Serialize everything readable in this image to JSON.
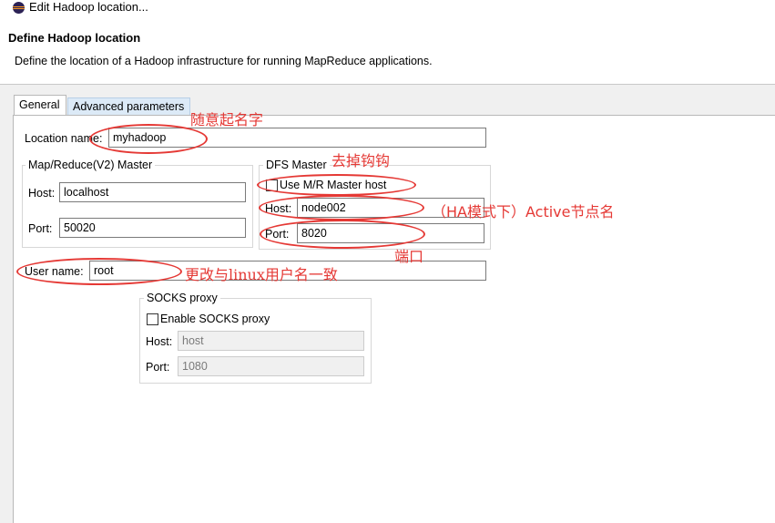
{
  "window": {
    "title": "Edit Hadoop location..."
  },
  "header": {
    "title": "Define Hadoop location",
    "description": "Define the location of a Hadoop infrastructure for running MapReduce applications."
  },
  "tabs": [
    {
      "label": "General",
      "selected": true
    },
    {
      "label": "Advanced parameters",
      "selected": false
    }
  ],
  "form": {
    "location_name": {
      "label": "Location name:",
      "value": "myhadoop"
    },
    "mapreduce_master": {
      "title": "Map/Reduce(V2) Master",
      "host": {
        "label": "Host:",
        "value": "localhost"
      },
      "port": {
        "label": "Port:",
        "value": "50020"
      }
    },
    "dfs_master": {
      "title": "DFS Master",
      "use_mr_host": {
        "label": "Use M/R Master host",
        "checked": false
      },
      "host": {
        "label": "Host:",
        "value": "node002"
      },
      "port": {
        "label": "Port:",
        "value": "8020"
      }
    },
    "user_name": {
      "label": "User name:",
      "value": "root"
    },
    "socks_proxy": {
      "title": "SOCKS proxy",
      "enable": {
        "label": "Enable SOCKS proxy",
        "checked": false
      },
      "host": {
        "label": "Host:",
        "value": "host"
      },
      "port": {
        "label": "Port:",
        "value": "1080"
      }
    }
  },
  "annotations": {
    "name_note": "随意起名字",
    "uncheck_note": "去掉钩钩",
    "active_note": "（HA模式下）Active节点名",
    "port_note": "端口",
    "user_note": "更改与linux用户名一致"
  },
  "colors": {
    "annotation": "#e53935",
    "tab_highlight": "#dceaf7"
  }
}
